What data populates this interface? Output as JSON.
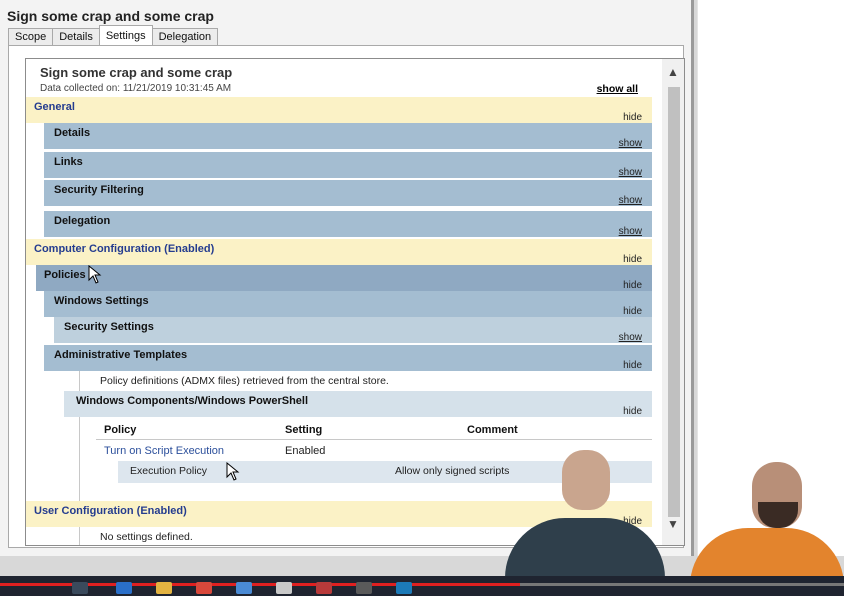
{
  "window": {
    "title": "Sign some crap and some crap",
    "tabs": [
      "Scope",
      "Details",
      "Settings",
      "Delegation"
    ],
    "active_tab": "Settings"
  },
  "report": {
    "title": "Sign some crap and some crap",
    "collected": "Data collected on: 11/21/2019 10:31:45 AM",
    "show_all": "show all",
    "general": {
      "label": "General",
      "action": "hide"
    },
    "details": {
      "label": "Details",
      "action": "show"
    },
    "links": {
      "label": "Links",
      "action": "show"
    },
    "security_filtering": {
      "label": "Security Filtering",
      "action": "show"
    },
    "delegation": {
      "label": "Delegation",
      "action": "show"
    },
    "computer_config": {
      "label": "Computer Configuration (Enabled)",
      "action": "hide"
    },
    "policies": {
      "label": "Policies",
      "action": "hide"
    },
    "windows_settings": {
      "label": "Windows Settings",
      "action": "hide"
    },
    "security_settings": {
      "label": "Security Settings",
      "action": "show"
    },
    "admin_templates": {
      "label": "Administrative Templates",
      "action": "hide"
    },
    "admx_note": "Policy definitions (ADMX files) retrieved from the central store.",
    "win_components": {
      "label": "Windows Components/Windows PowerShell",
      "action": "hide"
    },
    "table": {
      "headers": [
        "Policy",
        "Setting",
        "Comment"
      ],
      "policy": "Turn on Script Execution",
      "setting": "Enabled",
      "sub_label": "Execution Policy",
      "sub_value": "Allow only signed scripts"
    },
    "user_config": {
      "label": "User Configuration (Enabled)",
      "action": "hide"
    },
    "no_settings": "No settings defined."
  },
  "colors": {
    "yellow_band": "#fbf2c6",
    "blue_band": "#a4bdd1",
    "link": "#2b4f9b",
    "progress": "#e02020"
  },
  "icons": [
    "scroll-up-icon",
    "scroll-down-icon",
    "mouse-cursor-icon",
    "taskbar-app-icon"
  ]
}
